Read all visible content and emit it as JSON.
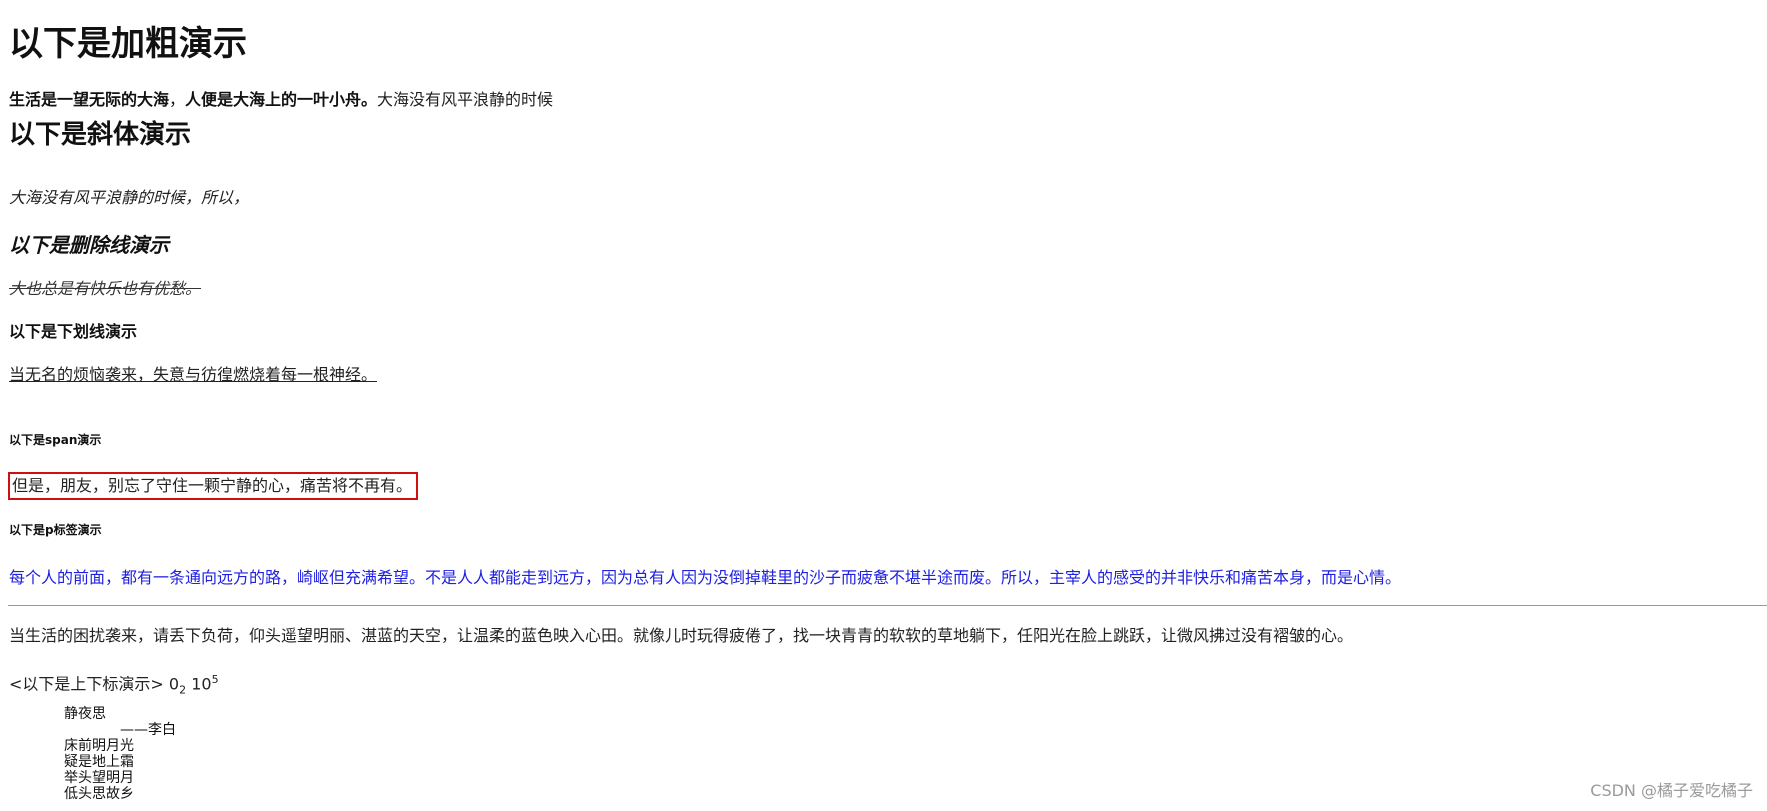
{
  "sections": {
    "bold_title": "以下是加粗演示",
    "bold_line": {
      "part1": "生活是一望无际的大海",
      "comma": "，",
      "part2": "人便是大海上的一叶小舟。",
      "rest": "大海没有风平浪静的时候"
    },
    "italic_title": "以下是斜体演示",
    "italic_line": "大海没有风平浪静的时候，所以，",
    "strike_title": "以下是删除线演示",
    "strike_line": "大也总是有快乐也有优愁。",
    "underline_title": "以下是下划线演示",
    "underline_line": "当无名的烦恼袭来，失意与彷徨燃烧着每一根神经。",
    "span_title": "以下是span演示",
    "span_line": "但是，朋友，别忘了守住一颗宁静的心，痛苦将不再有。",
    "p_title": "以下是p标签演示",
    "blue_line": "每个人的前面，都有一条通向远方的路，崎岖但充满希望。不是人人都能走到远方，因为总有人因为没倒掉鞋里的沙子而疲惫不堪半途而废。所以，主宰人的感受的并非快乐和痛苦本身，而是心情。",
    "plain_long_line": "当生活的困扰袭来，请丢下负荷，仰头遥望明丽、湛蓝的天空，让温柔的蓝色映入心田。就像儿时玩得疲倦了，找一块青青的软软的草地躺下，任阳光在脸上跳跃，让微风拂过没有褶皱的心。",
    "subsup": {
      "label": "<以下是上下标演示>",
      "base1": "0",
      "sub": "2",
      "base2": "10",
      "sup": "5"
    },
    "poem": {
      "title": "静夜思",
      "author": "——李白",
      "line1": "床前明月光",
      "line2": "疑是地上霜",
      "line3": "举头望明月",
      "line4": "低头思故乡"
    }
  },
  "watermark": "CSDN @橘子爱吃橘子",
  "colors": {
    "blue_text": "#2020e0",
    "span_border": "#d01010",
    "watermark": "#9a9a9a"
  }
}
